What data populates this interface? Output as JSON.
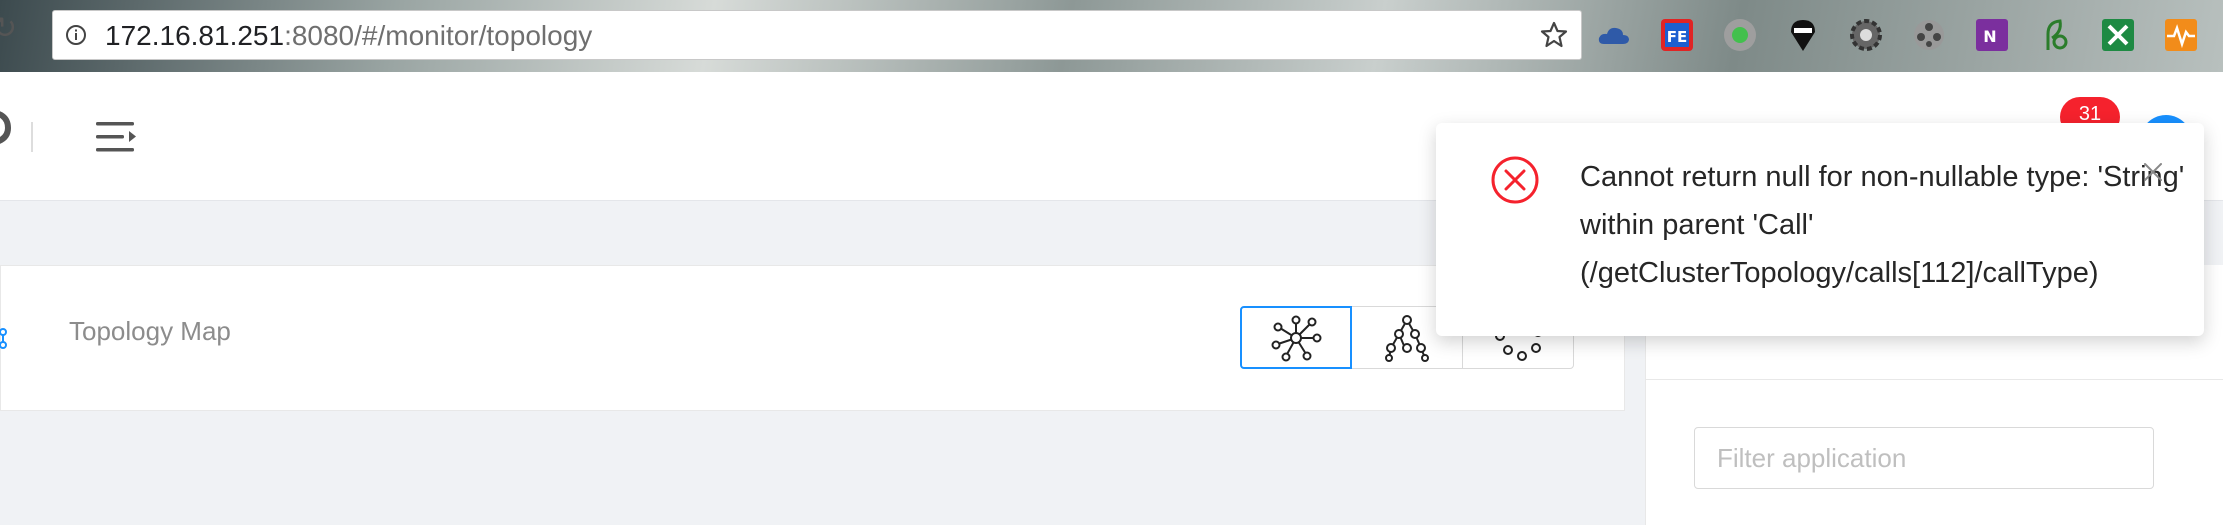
{
  "browser": {
    "url_host": "172.16.81.251",
    "url_rest": ":8080/#/monitor/topology",
    "extensions": [
      "cloud-icon",
      "fe-icon",
      "record-icon",
      "spy-icon",
      "gear-icon",
      "film-icon",
      "onenote-icon",
      "leaf-icon",
      "excel-icon",
      "pulse-icon"
    ]
  },
  "header": {
    "notification_count": "31"
  },
  "main": {
    "title": "Topology Map",
    "layout_options": [
      "force-layout-icon",
      "tree-layout-icon",
      "circle-layout-icon"
    ],
    "active_layout": 0
  },
  "side": {
    "filter_placeholder": "Filter application"
  },
  "toast": {
    "message": "Cannot return null for non-nullable type: 'String' within parent 'Call' (/getClusterTopology/calls[112]/callType)"
  },
  "colors": {
    "accent": "#1890ff",
    "error": "#f5222d"
  }
}
